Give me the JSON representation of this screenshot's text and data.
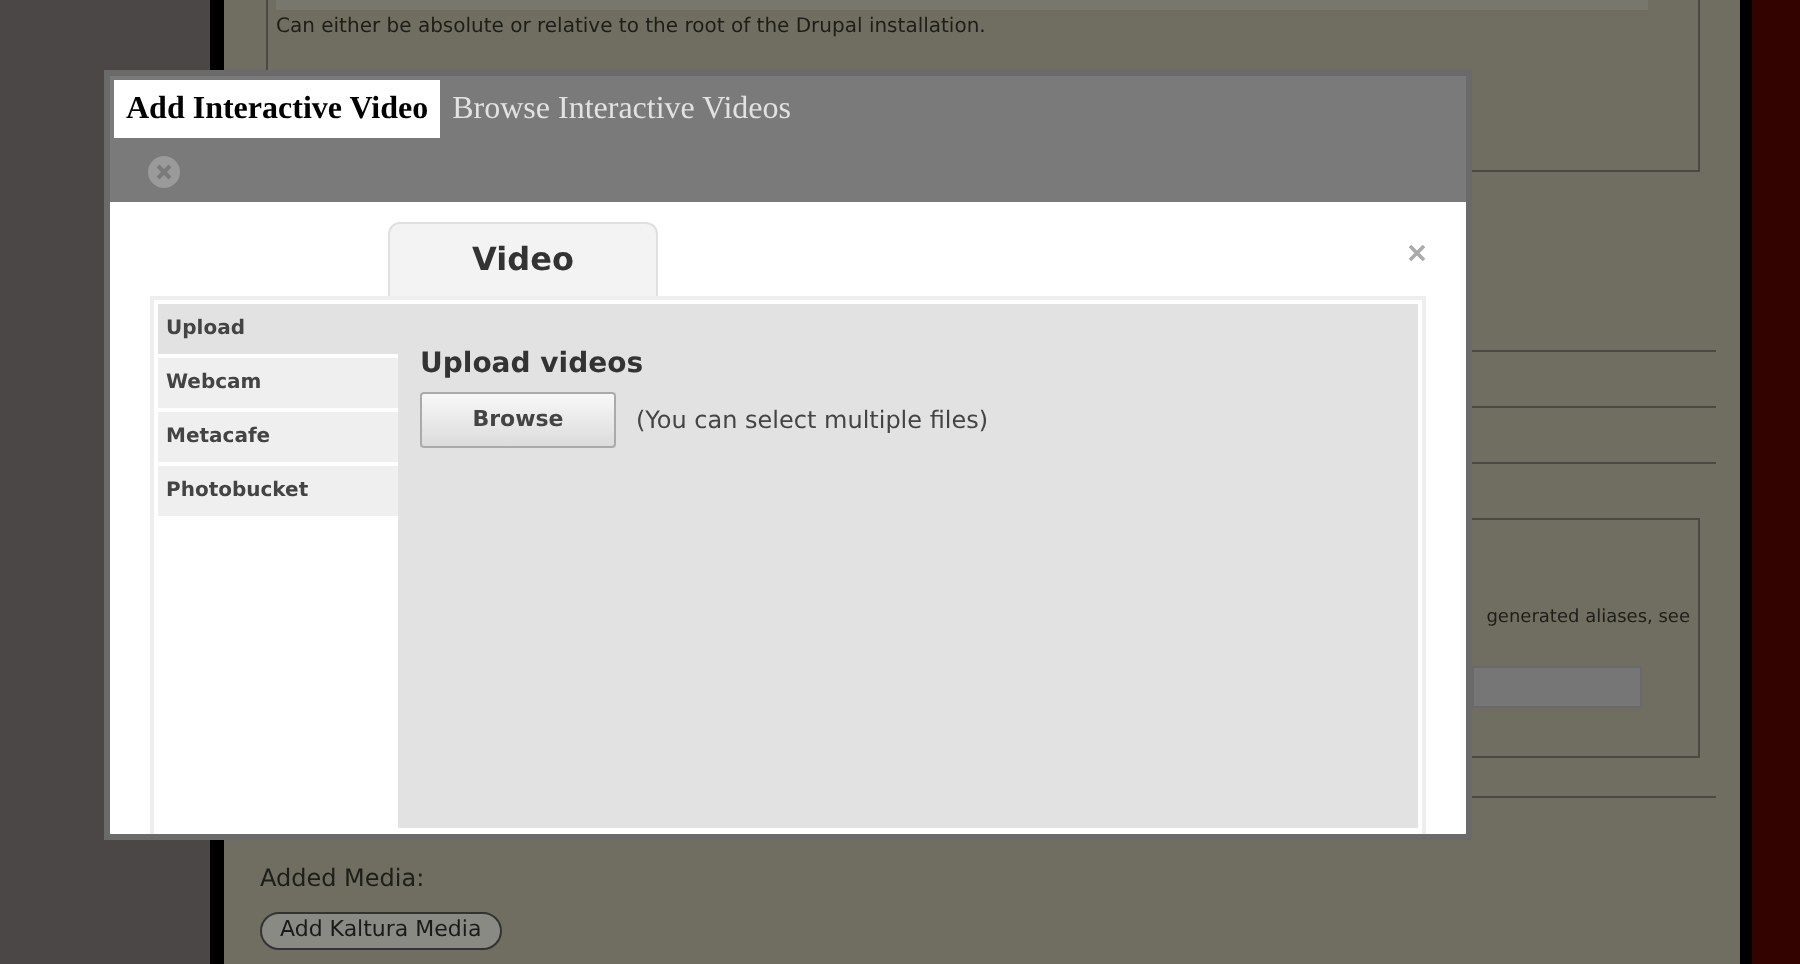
{
  "background_page": {
    "path_hint": "Can either be absolute or relative to the root of the Drupal installation.",
    "alias_text": "generated aliases, see",
    "added_media_label": "Added Media:",
    "add_media_button": "Add Kaltura Media"
  },
  "dialog": {
    "tabs": [
      {
        "label": "Add Interactive Video",
        "selected": true
      },
      {
        "label": "Browse Interactive Videos",
        "selected": false
      }
    ],
    "media_tabs": [
      {
        "label": "Video",
        "selected": true
      }
    ],
    "sources": [
      {
        "label": "Upload",
        "selected": true
      },
      {
        "label": "Webcam",
        "selected": false
      },
      {
        "label": "Metacafe",
        "selected": false
      },
      {
        "label": "Photobucket",
        "selected": false
      }
    ],
    "heading": "Upload videos",
    "browse_button": "Browse",
    "browse_note": "(You can select multiple files)"
  }
}
